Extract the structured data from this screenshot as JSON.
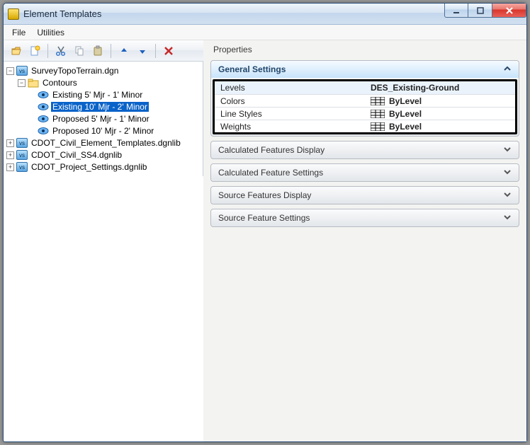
{
  "window": {
    "title": "Element Templates"
  },
  "menu": {
    "file": "File",
    "utilities": "Utilities"
  },
  "tree": {
    "root": "SurveyTopoTerrain.dgn",
    "contours_folder": "Contours",
    "items": {
      "ex5": "Existing 5' Mjr - 1' Minor",
      "ex10": "Existing 10' Mjr - 2' Minor",
      "pr5": "Proposed 5' Mjr - 1' Minor",
      "pr10": "Proposed 10' Mjr - 2' Minor"
    },
    "libs": {
      "a": "CDOT_Civil_Element_Templates.dgnlib",
      "b": "CDOT_Civil_SS4.dgnlib",
      "c": "CDOT_Project_Settings.dgnlib"
    }
  },
  "properties": {
    "title": "Properties",
    "general": {
      "header": "General Settings",
      "rows": {
        "levels": {
          "label": "Levels",
          "value": "DES_Existing-Ground"
        },
        "colors": {
          "label": "Colors",
          "value": "ByLevel"
        },
        "linestyles": {
          "label": "Line Styles",
          "value": "ByLevel"
        },
        "weights": {
          "label": "Weights",
          "value": "ByLevel"
        }
      }
    },
    "sections": {
      "calc_disp": "Calculated Features Display",
      "calc_set": "Calculated Feature Settings",
      "src_disp": "Source Features Display",
      "src_set": "Source Feature Settings"
    }
  }
}
